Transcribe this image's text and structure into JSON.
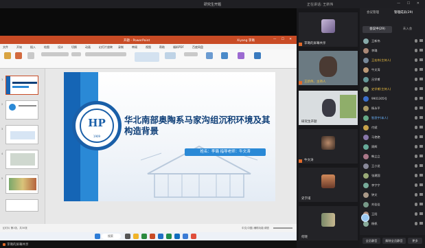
{
  "window": {
    "title": "研究生开题",
    "speaker": "正在讲话: 王新伟",
    "controls": "— ☐ ✕"
  },
  "powerpoint": {
    "titlebar": "开题 - PowerPoint",
    "user": "Xiyang 李璐",
    "menu": [
      "文件",
      "开始",
      "插入",
      "绘图",
      "设计",
      "切换",
      "动画",
      "幻灯片放映",
      "录制",
      "审阅",
      "视图",
      "帮助",
      "福昕PDF",
      "百度网盘"
    ],
    "slide_title": "华北南部奥陶系马家沟组沉积环境及其构造背景",
    "name_line": "姓名：李璐  指导老师：牛文涛",
    "logo_text": "HP",
    "logo_year": "1909",
    "status_left": "幻灯片 第1张，共30张",
    "status_right": "中文(中国)  辅助功能:调查",
    "search": "搜索",
    "thumb_numbers": [
      "1",
      "2",
      "3",
      "4",
      "5"
    ],
    "sharing": "李璐的屏幕共享"
  },
  "videos": [
    {
      "name": "李璐的屏幕共享"
    },
    {
      "name": "王新伟、主持人"
    },
    {
      "name": "研究生开题"
    },
    {
      "name": "牛文涛"
    },
    {
      "name": "史学甫"
    },
    {
      "name": "何晓"
    }
  ],
  "panel": {
    "tab_chat": "会议成员",
    "header_left": "会议管理",
    "header_right": "管理成员(29)",
    "tab_all": "会议中(29)",
    "tab_wait": "未入会",
    "members": [
      "王新伟",
      "李璐",
      "王宏伟(主持人)",
      "牛文涛",
      "吕学甫",
      "史学甫(主持人)",
      "9901305号",
      "杨永平",
      "智思宇(本人)",
      "付斌",
      "马艳艳",
      "周辉",
      "韩立立",
      "王小龙",
      "张建国",
      "李宁宁",
      "钟文",
      "刘佳佳",
      "王阳",
      "杨帆"
    ],
    "btn_mute": "全员静音",
    "btn_unmute": "解除全员静音",
    "btn_more": "更多"
  }
}
